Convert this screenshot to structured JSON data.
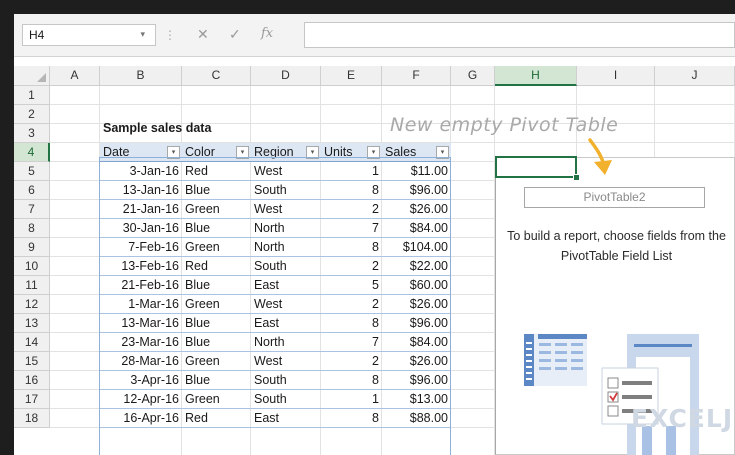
{
  "formula_bar": {
    "name_box": "H4",
    "name_box_dropdown": "▾",
    "separator": "⋮",
    "cancel_icon": "✕",
    "enter_icon": "✓",
    "function_icon": "fx",
    "formula": ""
  },
  "columns": [
    "A",
    "B",
    "C",
    "D",
    "E",
    "F",
    "G",
    "H",
    "I",
    "J"
  ],
  "rows": [
    "1",
    "2",
    "3",
    "4",
    "5",
    "6",
    "7",
    "8",
    "9",
    "10",
    "11",
    "12",
    "13",
    "14",
    "15",
    "16",
    "17",
    "18"
  ],
  "selected_cell": "H4",
  "sheet": {
    "title": "Sample sales data",
    "table": {
      "headers": [
        "Date",
        "Color",
        "Region",
        "Units",
        "Sales"
      ],
      "dropdown_glyph": "▾",
      "rows": [
        [
          "3-Jan-16",
          "Red",
          "West",
          "1",
          "$11.00"
        ],
        [
          "13-Jan-16",
          "Blue",
          "South",
          "8",
          "$96.00"
        ],
        [
          "21-Jan-16",
          "Green",
          "West",
          "2",
          "$26.00"
        ],
        [
          "30-Jan-16",
          "Blue",
          "North",
          "7",
          "$84.00"
        ],
        [
          "7-Feb-16",
          "Green",
          "North",
          "8",
          "$104.00"
        ],
        [
          "13-Feb-16",
          "Red",
          "South",
          "2",
          "$22.00"
        ],
        [
          "21-Feb-16",
          "Blue",
          "East",
          "5",
          "$60.00"
        ],
        [
          "1-Mar-16",
          "Green",
          "West",
          "2",
          "$26.00"
        ],
        [
          "13-Mar-16",
          "Blue",
          "East",
          "8",
          "$96.00"
        ],
        [
          "23-Mar-16",
          "Blue",
          "North",
          "7",
          "$84.00"
        ],
        [
          "28-Mar-16",
          "Green",
          "West",
          "2",
          "$26.00"
        ],
        [
          "3-Apr-16",
          "Blue",
          "South",
          "8",
          "$96.00"
        ],
        [
          "12-Apr-16",
          "Green",
          "South",
          "1",
          "$13.00"
        ],
        [
          "16-Apr-16",
          "Red",
          "East",
          "8",
          "$88.00"
        ]
      ]
    }
  },
  "pivot": {
    "annotation": "New empty Pivot Table",
    "name": "PivotTable2",
    "instructions": "To build a report, choose fields from the PivotTable Field List",
    "watermark": "EXCELJET"
  },
  "colors": {
    "excel_green": "#217346",
    "table_header_bg": "#dde7f3",
    "arrow": "#f2b12c",
    "illustration_blue": "#5b87c5"
  }
}
